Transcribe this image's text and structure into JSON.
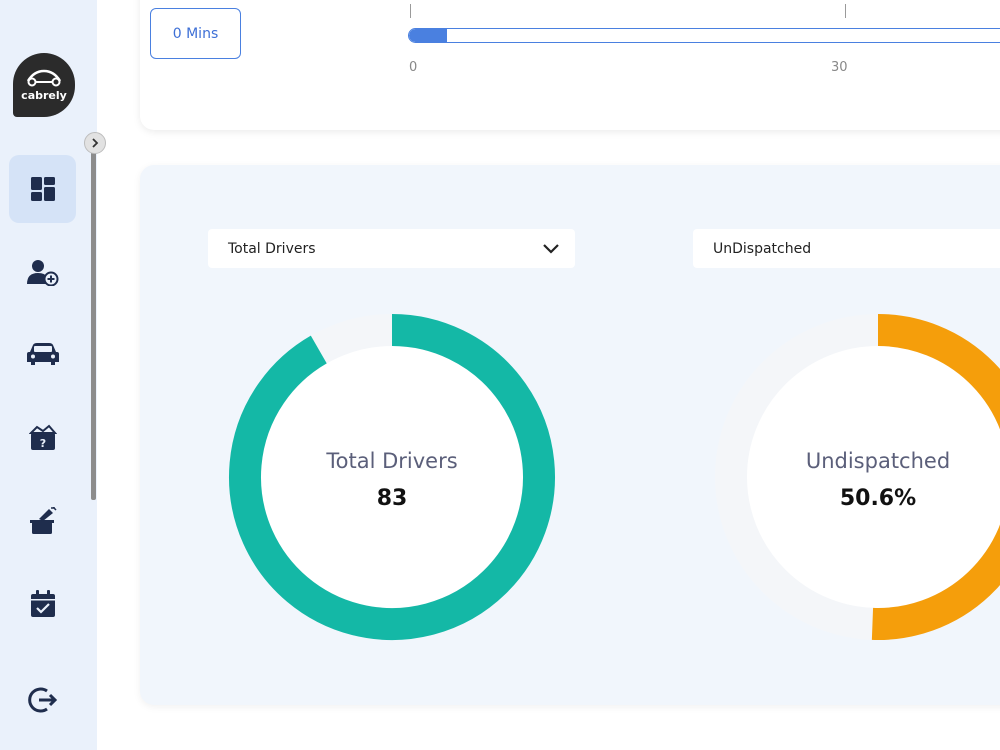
{
  "sidebar": {
    "logo_text": "cabrely",
    "items": [
      {
        "icon": "dashboard-icon",
        "active": true
      },
      {
        "icon": "add-user-icon",
        "active": false
      },
      {
        "icon": "car-icon",
        "active": false
      },
      {
        "icon": "help-box-icon",
        "active": false
      },
      {
        "icon": "dispatch-box-icon",
        "active": false
      },
      {
        "icon": "calendar-check-icon",
        "active": false
      }
    ],
    "logout_icon": "logout-icon"
  },
  "top_panel": {
    "mins_button_label": "0 Mins",
    "slider": {
      "value": 0,
      "ticks": [
        "0",
        "30"
      ]
    }
  },
  "charts": {
    "total_drivers": {
      "dropdown_label": "Total Drivers",
      "center_title": "Total Drivers",
      "center_value": "83",
      "color": "#14b8a6"
    },
    "undispatched": {
      "dropdown_label": "UnDispatched",
      "center_title": "Undispatched",
      "center_value": "50.6%",
      "color": "#f59e0b"
    }
  },
  "colors": {
    "accent": "#4a80e0",
    "sidebar_bg": "#eaf1fb",
    "card_bg": "#f1f6fc",
    "track": "#f4f6f9"
  }
}
